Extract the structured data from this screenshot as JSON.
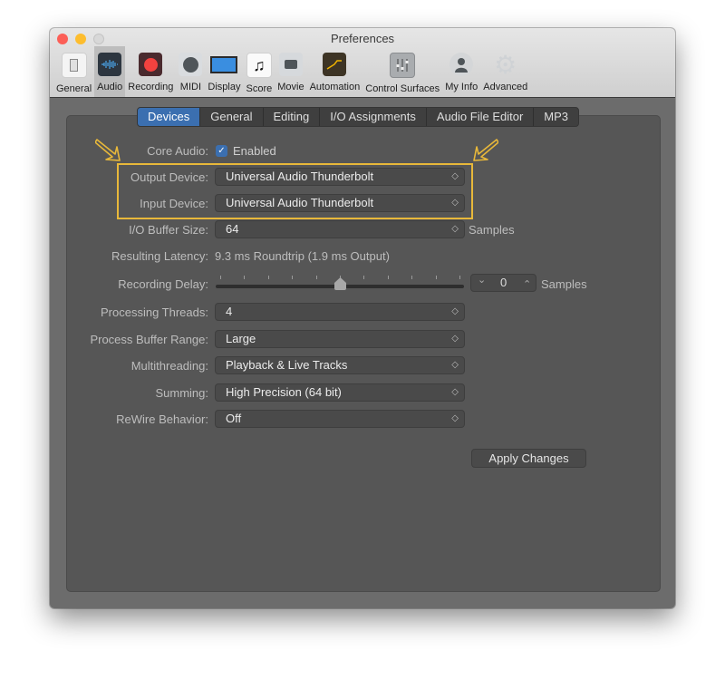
{
  "window": {
    "title": "Preferences"
  },
  "toolbar": {
    "items": [
      {
        "label": "General",
        "icon": "switch-icon"
      },
      {
        "label": "Audio",
        "icon": "waveform-icon",
        "active": true
      },
      {
        "label": "Recording",
        "icon": "record-icon"
      },
      {
        "label": "MIDI",
        "icon": "midi-connector-icon"
      },
      {
        "label": "Display",
        "icon": "monitor-icon"
      },
      {
        "label": "Score",
        "icon": "music-note-icon"
      },
      {
        "label": "Movie",
        "icon": "video-camera-icon"
      },
      {
        "label": "Automation",
        "icon": "automation-curve-icon"
      },
      {
        "label": "Control Surfaces",
        "icon": "faders-icon"
      },
      {
        "label": "My Info",
        "icon": "user-silhouette-icon"
      },
      {
        "label": "Advanced",
        "icon": "gear-icon"
      }
    ]
  },
  "tabs": [
    {
      "label": "Devices",
      "selected": true
    },
    {
      "label": "General"
    },
    {
      "label": "Editing"
    },
    {
      "label": "I/O Assignments"
    },
    {
      "label": "Audio File Editor"
    },
    {
      "label": "MP3"
    }
  ],
  "form": {
    "core_audio": {
      "label": "Core Audio:",
      "checkbox_label": "Enabled",
      "checked": true
    },
    "output_device": {
      "label": "Output Device:",
      "value": "Universal Audio Thunderbolt"
    },
    "input_device": {
      "label": "Input Device:",
      "value": "Universal Audio Thunderbolt"
    },
    "io_buffer_size": {
      "label": "I/O Buffer Size:",
      "value": "64",
      "unit": "Samples"
    },
    "resulting_latency": {
      "label": "Resulting Latency:",
      "value": "9.3 ms Roundtrip (1.9 ms Output)"
    },
    "recording_delay": {
      "label": "Recording Delay:",
      "value": "0",
      "unit": "Samples",
      "slider_position": 0.5,
      "down_glyph": "⌄",
      "up_glyph": "⌃"
    },
    "processing_threads": {
      "label": "Processing Threads:",
      "value": "4"
    },
    "process_buffer_range": {
      "label": "Process Buffer Range:",
      "value": "Large"
    },
    "multithreading": {
      "label": "Multithreading:",
      "value": "Playback & Live Tracks"
    },
    "summing": {
      "label": "Summing:",
      "value": "High Precision (64 bit)"
    },
    "rewire_behavior": {
      "label": "ReWire Behavior:",
      "value": "Off"
    }
  },
  "buttons": {
    "apply_changes": "Apply Changes"
  },
  "annotation": {
    "highlight_color": "#e8b83a"
  },
  "glyphs": {
    "popup_chevron": "◇",
    "checkmark": "✓"
  }
}
